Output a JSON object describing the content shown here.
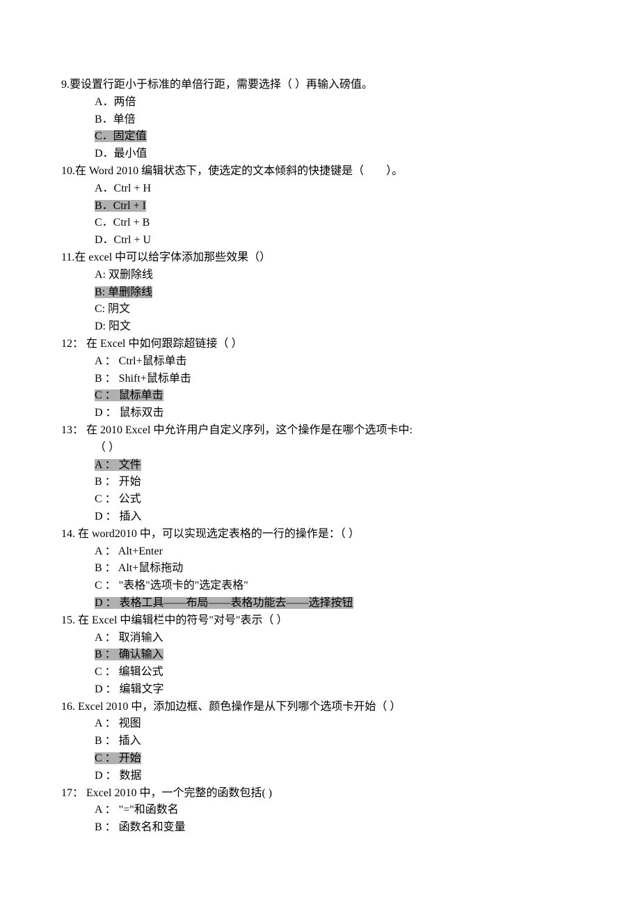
{
  "questions": [
    {
      "num": "9.",
      "stem": "要设置行距小于标准的单倍行距，需要选择（ ）再输入磅值。",
      "options": [
        {
          "label": "A．两倍",
          "hl": false
        },
        {
          "label": "B．单倍",
          "hl": false
        },
        {
          "label": "C．固定值",
          "hl": true
        },
        {
          "label": "D．最小值",
          "hl": false
        }
      ]
    },
    {
      "num": "10.",
      "stem": "在 Word 2010 编辑状态下，使选定的文本倾斜的快捷键是（　　）。",
      "options": [
        {
          "label": "A．Ctrl + H",
          "hl": false
        },
        {
          "label": "B．Ctrl + I",
          "hl": true
        },
        {
          "label": "C．Ctrl + B",
          "hl": false
        },
        {
          "label": "D．Ctrl + U",
          "hl": false
        }
      ]
    },
    {
      "num": "11.",
      "stem": "在 excel 中可以给字体添加那些效果（）",
      "options": [
        {
          "label": "A: 双删除线",
          "hl": false
        },
        {
          "label": "B: 单删除线",
          "hl": true
        },
        {
          "label": "C: 阴文",
          "hl": false
        },
        {
          "label": "D: 阳文",
          "hl": false
        }
      ]
    },
    {
      "num": "12：",
      "stem": " 在 Excel 中如何跟踪超链接（  ）",
      "options": [
        {
          "label": "A ：  Ctrl+鼠标单击",
          "hl": false
        },
        {
          "label": "B ：  Shift+鼠标单击",
          "hl": false
        },
        {
          "label": "C ：  鼠标单击",
          "hl": true
        },
        {
          "label": "D ：  鼠标双击",
          "hl": false
        }
      ]
    },
    {
      "num": "13：",
      "stem": " 在 2010 Excel 中允许用户自定义序列，这个操作是在哪个选项卡中:",
      "stem2": "（ ）",
      "options": [
        {
          "label": "A ：  文件",
          "hl": true
        },
        {
          "label": "B ：  开始",
          "hl": false
        },
        {
          "label": "C ：  公式",
          "hl": false
        },
        {
          "label": "D ：  插入",
          "hl": false
        }
      ]
    },
    {
      "num": "14.",
      "stem": " 在 word2010 中，可以实现选定表格的一行的操作是：（  ）",
      "options": [
        {
          "label": "A ：  Alt+Enter",
          "hl": false
        },
        {
          "label": "B ：  Alt+鼠标拖动",
          "hl": false
        },
        {
          "label": "C ：  \"表格\"选项卡的\"选定表格\"",
          "hl": false
        },
        {
          "label": "D ：  表格工具——布局——表格功能去——选择按钮",
          "hl": true
        }
      ]
    },
    {
      "num": "15.",
      "stem": " 在 Excel 中编辑栏中的符号\"对号\"表示（  ）",
      "options": [
        {
          "label": "A ：  取消输入",
          "hl": false
        },
        {
          "label": "B ：  确认输入",
          "hl": true
        },
        {
          "label": "C ：  编辑公式",
          "hl": false
        },
        {
          "label": "D ：  编辑文字",
          "hl": false
        }
      ]
    },
    {
      "num": "16.",
      "stem": " Excel 2010 中，添加边框、颜色操作是从下列哪个选项卡开始（  ）",
      "options": [
        {
          "label": "A ：  视图",
          "hl": false
        },
        {
          "label": "B ：  插入",
          "hl": false
        },
        {
          "label": "C ：  开始",
          "hl": true
        },
        {
          "label": "D ：  数据",
          "hl": false
        }
      ]
    },
    {
      "num": "17：",
      "stem": " Excel 2010 中，一个完整的函数包括( )",
      "options": [
        {
          "label": "A ：  \"=\"和函数名",
          "hl": false
        },
        {
          "label": "B ：  函数名和变量",
          "hl": false
        }
      ]
    }
  ]
}
